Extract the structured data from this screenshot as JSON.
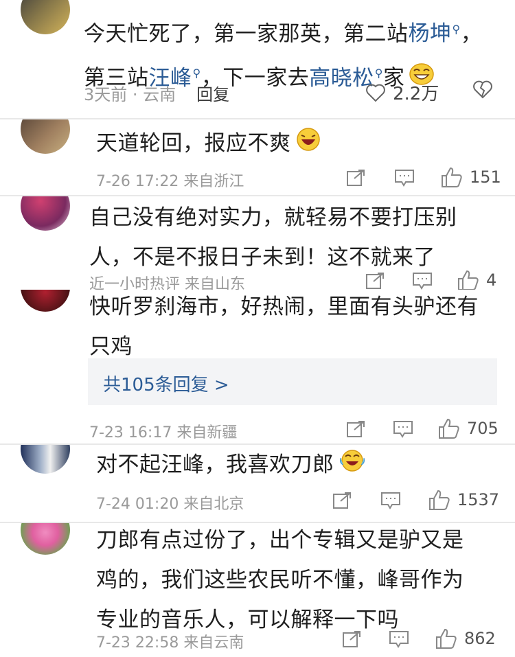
{
  "comments": [
    {
      "text_parts": [
        "今天忙死了，第一家那英，第二站",
        "杨坤",
        "，第三站",
        "汪峰",
        "，下一家去",
        "高晓松",
        "家"
      ],
      "meta": "3天前 · 云南",
      "reply_label": "回复",
      "like_count": "2.2万"
    },
    {
      "text": "天道轮回，报应不爽",
      "meta": "7-26 17:22  来自浙江",
      "like_count": "151"
    },
    {
      "text_line1": "自己没有绝对实力，就轻易不要打压别",
      "text_line2": "人，不是不报日子未到！这不就来了",
      "meta": "近一小时热评  来自山东",
      "like_count": "4"
    },
    {
      "text_line1": "快听罗刹海市，好热闹，里面有头驴还有",
      "text_line2": "只鸡",
      "more_replies": "共105条回复 >",
      "meta": "7-23 16:17  来自新疆",
      "like_count": "705"
    },
    {
      "text": "对不起汪峰，我喜欢刀郎",
      "meta": "7-24 01:20  来自北京",
      "like_count": "1537"
    },
    {
      "text_line1": "刀郎有点过份了，出个专辑又是驴又是",
      "text_line2": "鸡的，我们这些农民听不懂，峰哥作为",
      "text_line3": "专业的音乐人，可以解释一下吗",
      "meta": "7-23 22:58  来自云南",
      "like_count": "862"
    }
  ],
  "icons": {
    "search_mark": "magnifier-icon",
    "share": "share-icon",
    "comment": "comment-icon",
    "like": "thumbs-up-icon",
    "heart": "heart-icon",
    "dislike": "broken-heart-icon"
  },
  "colors": {
    "link": "#2c5c96",
    "meta": "#9a9a9a",
    "separator": "#e8e8e8"
  }
}
